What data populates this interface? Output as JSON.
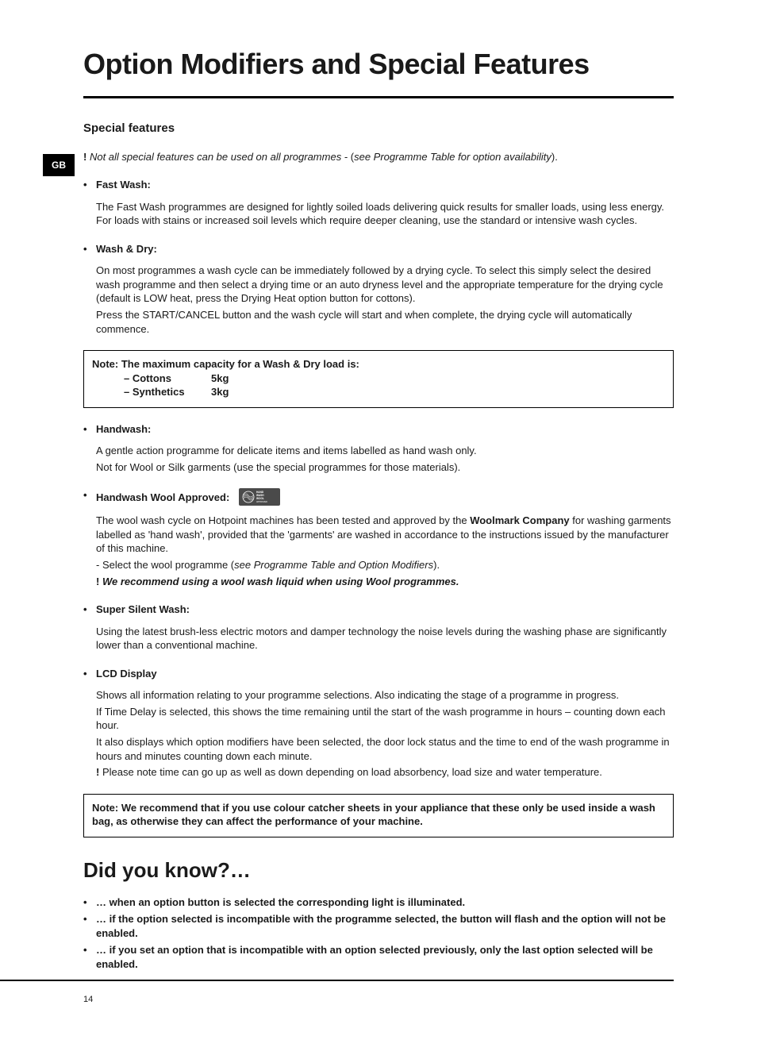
{
  "language_badge": "GB",
  "main_title": "Option Modifiers and Special Features",
  "section_title": "Special features",
  "intro_warning": {
    "prefix": "!",
    "italic_text": "Not all special features can be used on all programmes - ",
    "paren_open": "(",
    "paren_text": "see Programme Table for option availability",
    "paren_close": ")."
  },
  "features": {
    "fast_wash": {
      "label": "Fast Wash:",
      "body": "The Fast Wash programmes are designed for lightly soiled loads delivering quick results for smaller loads, using less energy. For loads with stains or increased soil levels which require deeper cleaning, use the standard or intensive wash cycles."
    },
    "wash_dry": {
      "label": "Wash & Dry:",
      "body1": "On most programmes a wash cycle can be immediately followed by a drying cycle. To select this simply select the desired wash programme and then select a drying time or an auto dryness level and the appropriate temperature for the drying cycle (default is LOW heat, press the Drying Heat option button for cottons).",
      "body2": "Press the START/CANCEL button and the wash cycle will start and when complete, the drying cycle will automatically commence."
    },
    "handwash": {
      "label": "Handwash:",
      "body1": "A gentle action programme for delicate items and items labelled as hand wash only.",
      "body2": "Not for Wool or Silk garments (use the special programmes for those materials)."
    },
    "handwash_wool": {
      "label": "Handwash Wool Approved:",
      "body1_pre": "The wool wash cycle on Hotpoint machines has been tested and approved by the ",
      "woolmark": "Woolmark Company",
      "body1_post": " for washing garments labelled as 'hand wash', provided that the 'garments' are washed in accordance to the instructions issued by the manufacturer of this machine.",
      "body2_pre": "- Select the wool programme (",
      "body2_ital": "see Programme Table and Option Modifiers",
      "body2_post": ").",
      "body3_bang": "!",
      "body3_text": "We recommend using a wool wash liquid when using Wool programmes."
    },
    "super_silent": {
      "label": "Super Silent Wash:",
      "body": "Using the latest brush-less electric motors and damper technology the noise levels during the washing phase are significantly lower than a conventional machine."
    },
    "lcd": {
      "label": "LCD Display",
      "body1": "Shows all information relating to your programme selections. Also indicating the stage of a programme in progress.",
      "body2": "If Time Delay is selected, this shows the time remaining until the start of the wash programme in hours – counting down each hour.",
      "body3": "It also displays which option modifiers have been selected, the door lock status and the time to end of the wash programme in hours and minutes counting down each minute.",
      "body4_bang": "!",
      "body4_text": " Please note time can go up as well as down depending on load absorbency, load size and water temperature."
    }
  },
  "capacity_note": {
    "title": "Note: The maximum capacity for a Wash & Dry load is:",
    "rows": [
      {
        "mat": "– Cottons",
        "val": "5kg"
      },
      {
        "mat": "– Synthetics",
        "val": "3kg"
      }
    ]
  },
  "colour_catcher_note": "Note: We recommend that if you use colour catcher sheets in your appliance that these only be used inside a wash bag, as otherwise they can affect the performance of your machine.",
  "dyk_title": "Did you know?…",
  "dyk_items": [
    "… when an option button is selected the corresponding light is illuminated.",
    "… if the option selected is incompatible with the programme selected, the button will flash and the option will not be enabled.",
    "… if you set an option that is incompatible with an option selected previously, only the last option selected will be enabled."
  ],
  "page_number": "14"
}
